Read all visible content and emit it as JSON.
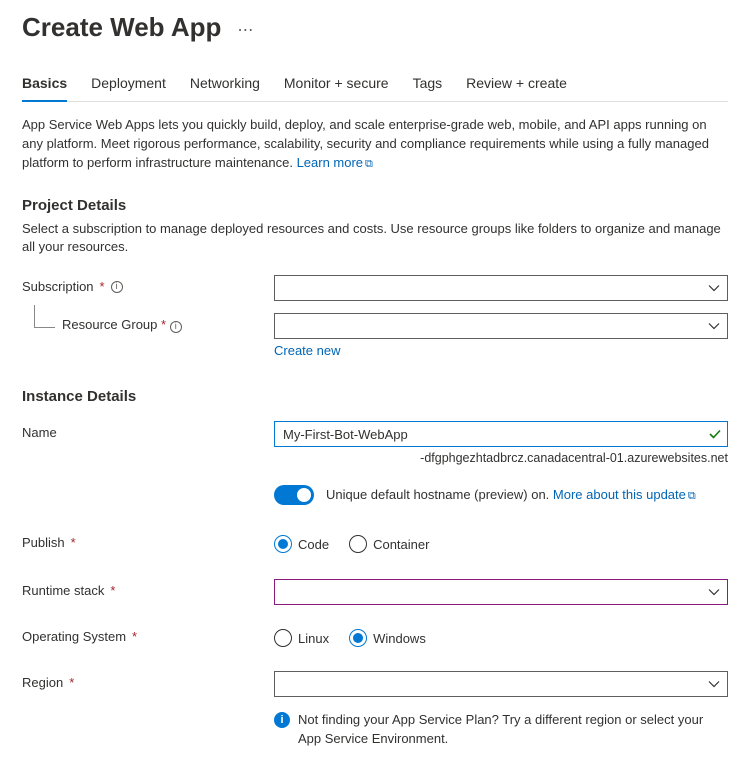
{
  "header": {
    "title": "Create Web App"
  },
  "tabs": {
    "items": [
      {
        "label": "Basics"
      },
      {
        "label": "Deployment"
      },
      {
        "label": "Networking"
      },
      {
        "label": "Monitor + secure"
      },
      {
        "label": "Tags"
      },
      {
        "label": "Review + create"
      }
    ],
    "active_index": 0
  },
  "intro": {
    "text": "App Service Web Apps lets you quickly build, deploy, and scale enterprise-grade web, mobile, and API apps running on any platform. Meet rigorous performance, scalability, security and compliance requirements while using a fully managed platform to perform infrastructure maintenance.  ",
    "learn_more": "Learn more"
  },
  "project_details": {
    "title": "Project Details",
    "desc": "Select a subscription to manage deployed resources and costs. Use resource groups like folders to organize and manage all your resources.",
    "subscription_label": "Subscription",
    "resource_group_label": "Resource Group",
    "create_new": "Create new"
  },
  "instance_details": {
    "title": "Instance Details",
    "name_label": "Name",
    "name_value": "My-First-Bot-WebApp",
    "name_suffix": "-dfgphgezhtadbrcz.canadacentral-01.azurewebsites.net",
    "hostname_toggle_label_prefix": "Unique default hostname (preview) on. ",
    "hostname_more": "More about this update",
    "publish_label": "Publish",
    "publish_options": {
      "code": "Code",
      "container": "Container"
    },
    "runtime_label": "Runtime stack",
    "os_label": "Operating System",
    "os_options": {
      "linux": "Linux",
      "windows": "Windows"
    },
    "region_label": "Region",
    "region_hint": "Not finding your App Service Plan? Try a different region or select your App Service Environment."
  }
}
